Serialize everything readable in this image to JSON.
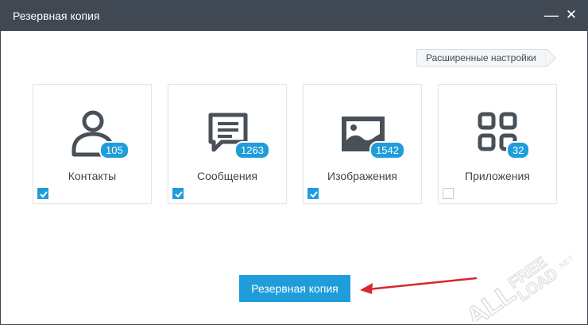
{
  "window": {
    "title": "Резервная копия",
    "minimize_glyph": "—",
    "close_glyph": "✕"
  },
  "advanced_settings_label": "Расширенные настройки",
  "cards": [
    {
      "label": "Контакты",
      "count": "105",
      "icon": "contact-person-icon",
      "checked": true
    },
    {
      "label": "Сообщения",
      "count": "1263",
      "icon": "message-bubble-icon",
      "checked": true
    },
    {
      "label": "Изображения",
      "count": "1542",
      "icon": "picture-icon",
      "checked": true
    },
    {
      "label": "Приложения",
      "count": "32",
      "icon": "apps-grid-icon",
      "checked": false
    }
  ],
  "backup_button_label": "Резервная копия",
  "watermark": "ALL-FREELOAD.NET",
  "colors": {
    "titlebar": "#3f4853",
    "accent": "#1f9ddb",
    "icon": "#4a5058",
    "arrow": "#d9262a"
  }
}
